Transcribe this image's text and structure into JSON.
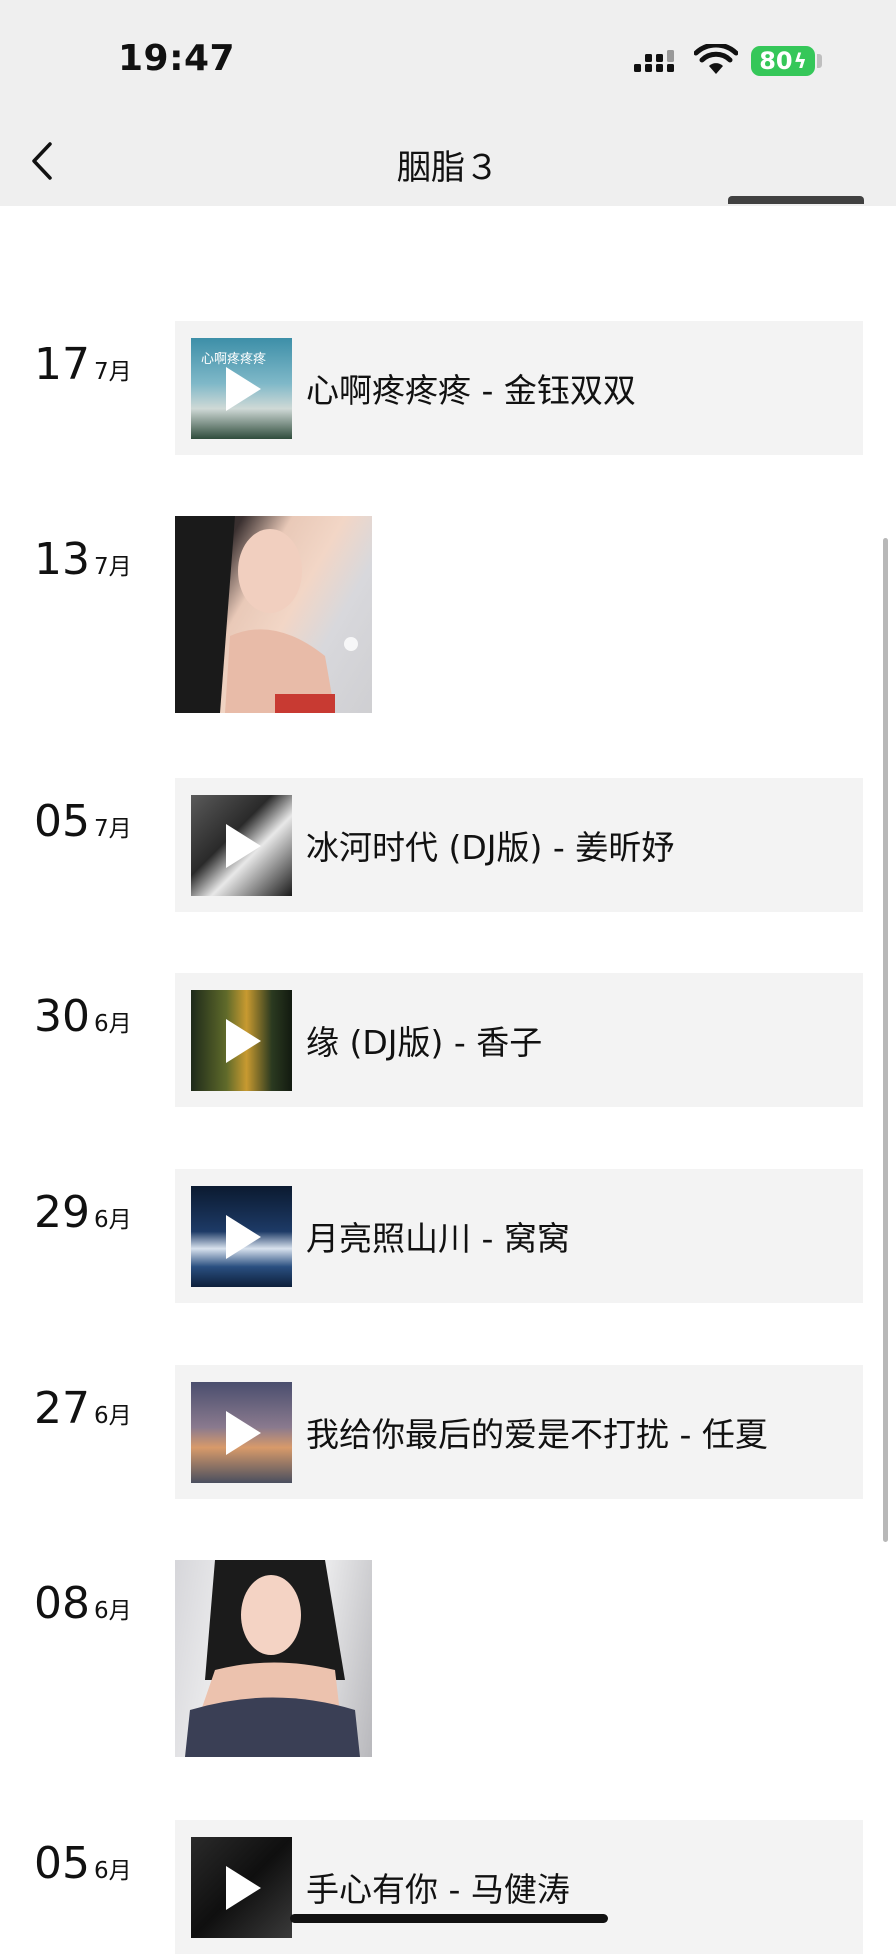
{
  "status_bar": {
    "time": "19:47",
    "battery": "80"
  },
  "header": {
    "title": "胭脂３"
  },
  "posts": [
    {
      "day": "17",
      "month": "7月",
      "type": "music",
      "song": "心啊疼疼疼 - 金钰双双",
      "cover_text": "心啊疼疼疼"
    },
    {
      "day": "13",
      "month": "7月",
      "type": "photo"
    },
    {
      "day": "05",
      "month": "7月",
      "type": "music",
      "song": "冰河时代 (DJ版) - 姜昕妤"
    },
    {
      "day": "30",
      "month": "6月",
      "type": "music",
      "song": "缘 (DJ版) - 香子"
    },
    {
      "day": "29",
      "month": "6月",
      "type": "music",
      "song": "月亮照山川 - 窝窝"
    },
    {
      "day": "27",
      "month": "6月",
      "type": "music",
      "song": "我给你最后的爱是不打扰 - 任夏"
    },
    {
      "day": "08",
      "month": "6月",
      "type": "photo"
    },
    {
      "day": "05",
      "month": "6月",
      "type": "music",
      "song": "手心有你 - 马健涛"
    }
  ],
  "colors": {
    "card_bg": "#f3f3f3",
    "header_bg": "#efefef",
    "battery": "#35c759"
  }
}
